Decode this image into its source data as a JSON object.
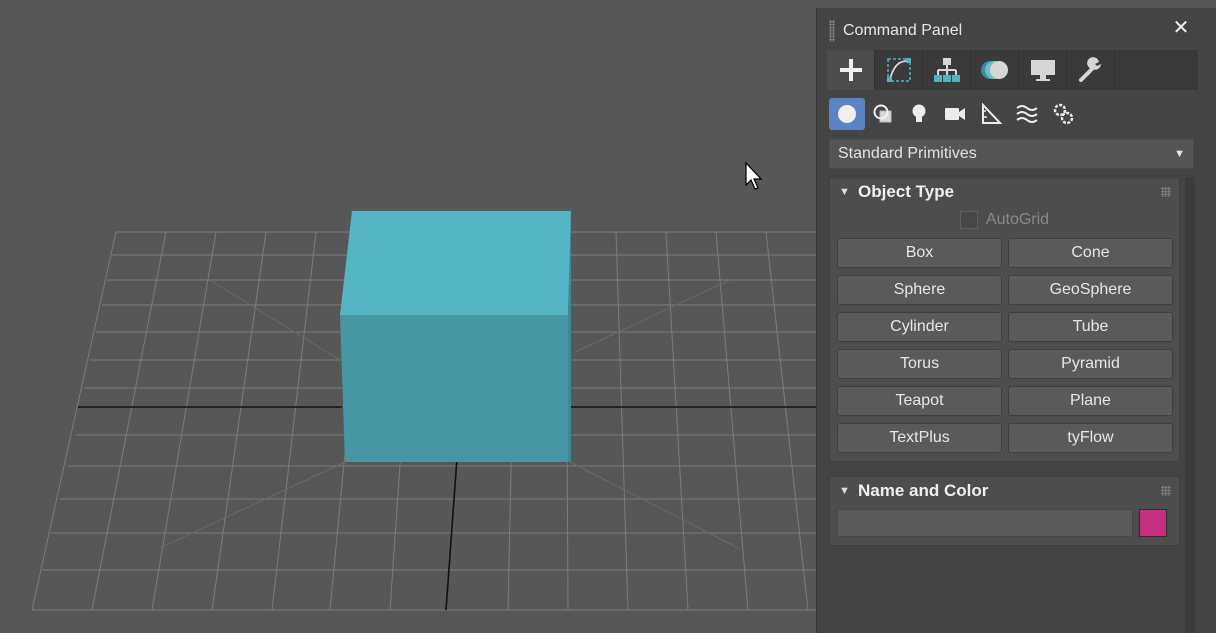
{
  "panel": {
    "title": "Command Panel",
    "close_label": "✕",
    "tabs": [
      {
        "icon": "create-plus-icon",
        "active": true
      },
      {
        "icon": "modify-curve-icon",
        "active": false
      },
      {
        "icon": "hierarchy-icon",
        "active": false
      },
      {
        "icon": "motion-icon",
        "active": false
      },
      {
        "icon": "display-monitor-icon",
        "active": false
      },
      {
        "icon": "utilities-wrench-icon",
        "active": false
      }
    ],
    "categories": [
      {
        "icon": "geometry-sphere-icon",
        "active": true
      },
      {
        "icon": "shapes-icon",
        "active": false
      },
      {
        "icon": "lights-bulb-icon",
        "active": false
      },
      {
        "icon": "cameras-icon",
        "active": false
      },
      {
        "icon": "helpers-ruler-icon",
        "active": false
      },
      {
        "icon": "space-warps-icon",
        "active": false
      },
      {
        "icon": "systems-gears-icon",
        "active": false
      }
    ],
    "dropdown": {
      "selected": "Standard Primitives"
    }
  },
  "object_type": {
    "title": "Object Type",
    "autogrid_label": "AutoGrid",
    "buttons": [
      "Box",
      "Cone",
      "Sphere",
      "GeoSphere",
      "Cylinder",
      "Tube",
      "Torus",
      "Pyramid",
      "Teapot",
      "Plane",
      "TextPlus",
      "tyFlow"
    ]
  },
  "name_color": {
    "title": "Name and Color",
    "name_value": "",
    "color": "#c4307f"
  },
  "colors": {
    "viewport_bg": "#575757",
    "cube_top": "#56b5c4",
    "cube_front": "#4696a4",
    "accent": "#5b84c4"
  }
}
